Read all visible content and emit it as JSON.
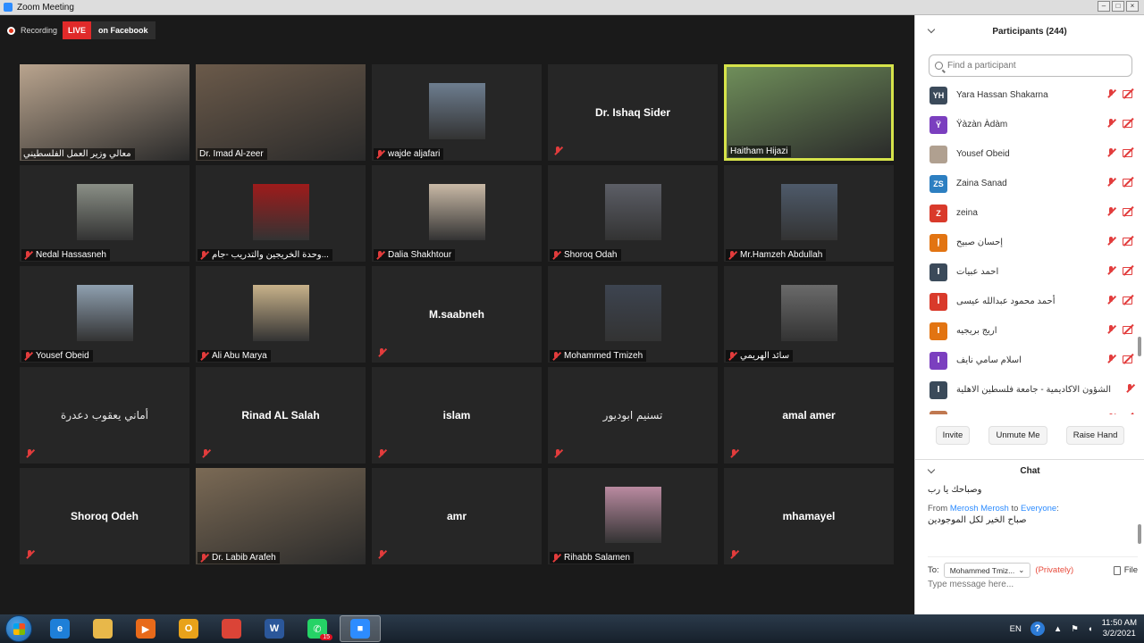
{
  "window": {
    "title": "Zoom Meeting"
  },
  "topbar": {
    "recording_label": "Recording",
    "live_label": "LIVE",
    "platform_label": "on Facebook"
  },
  "tiles": [
    {
      "name": "معالي وزير العمل الفلسطيني",
      "muted": false,
      "type": "video",
      "bg": "#b9a48e"
    },
    {
      "name": "Dr. Imad Al-zeer",
      "muted": false,
      "type": "video",
      "bg": "#6b5a4a"
    },
    {
      "name": "wajde aljafari",
      "muted": true,
      "type": "photo",
      "bg": "#6d7d8f"
    },
    {
      "name": "Dr. Ishaq Sider",
      "muted": true,
      "type": "name"
    },
    {
      "name": "Haitham Hijazi",
      "muted": false,
      "type": "video",
      "bg": "#6f8e5a",
      "active": true
    },
    {
      "name": "Nedal Hassasneh",
      "muted": true,
      "type": "photo",
      "bg": "#8a8f86"
    },
    {
      "name": "وحدة الخريجين والتدريب -جام...",
      "muted": true,
      "type": "photo",
      "bg": "#9e1b1b"
    },
    {
      "name": "Dalia Shakhtour",
      "muted": true,
      "type": "photo",
      "bg": "#c9b9a6"
    },
    {
      "name": "Shoroq Odah",
      "muted": true,
      "type": "photo",
      "bg": "#5c5e66"
    },
    {
      "name": "Mr.Hamzeh Abdullah",
      "muted": true,
      "type": "photo",
      "bg": "#4e5a6a"
    },
    {
      "name": "Yousef Obeid",
      "muted": true,
      "type": "photo",
      "bg": "#8fa0b0"
    },
    {
      "name": "Ali Abu Marya",
      "muted": true,
      "type": "photo",
      "bg": "#c8b28a"
    },
    {
      "name": "M.saabneh",
      "muted": true,
      "type": "name"
    },
    {
      "name": "Mohammed Tmizeh",
      "muted": true,
      "type": "photo",
      "bg": "#3d4450"
    },
    {
      "name": "سائد الهريمي",
      "muted": true,
      "type": "photo",
      "bg": "#6a6a6a"
    },
    {
      "name": "أماني يعقوب دعدرة",
      "muted": true,
      "type": "name",
      "arabic": true
    },
    {
      "name": "Rinad AL Salah",
      "muted": true,
      "type": "name"
    },
    {
      "name": "islam",
      "muted": true,
      "type": "name"
    },
    {
      "name": "تسنيم ابوديور",
      "muted": true,
      "type": "name",
      "arabic": true
    },
    {
      "name": "amal amer",
      "muted": true,
      "type": "name"
    },
    {
      "name": "Shoroq Odeh",
      "muted": true,
      "type": "name"
    },
    {
      "name": "Dr. Labib Arafeh",
      "muted": true,
      "type": "video",
      "bg": "#7b6a55"
    },
    {
      "name": "amr",
      "muted": true,
      "type": "name"
    },
    {
      "name": "Rihabb Salamen",
      "muted": true,
      "type": "photo",
      "bg": "#b98aa0"
    },
    {
      "name": "mhamayel",
      "muted": true,
      "type": "name"
    }
  ],
  "participants_panel": {
    "title": "Participants (244)",
    "search_placeholder": "Find a participant",
    "participants": [
      {
        "initials": "YH",
        "name": "Yara Hassan Shakarna",
        "color": "#3b4a5a"
      },
      {
        "initials": "Ÿ",
        "name": "Ÿàzàn Àdàm",
        "color": "#7b3fbf"
      },
      {
        "initials": "",
        "name": "Yousef Obeid",
        "color": "#b0a090",
        "photo": true
      },
      {
        "initials": "ZS",
        "name": "Zaina Sanad",
        "color": "#2d7fc1"
      },
      {
        "initials": "Z",
        "name": "zeina",
        "color": "#d93a2b"
      },
      {
        "initials": "إ",
        "name": "إحسان صبيح",
        "color": "#e27412"
      },
      {
        "initials": "ا",
        "name": "احمد عبيات",
        "color": "#3b4a5a"
      },
      {
        "initials": "أ",
        "name": "أحمد محمود عبدالله عيسى",
        "color": "#d93a2b"
      },
      {
        "initials": "ا",
        "name": "اريج بريجيه",
        "color": "#e27412"
      },
      {
        "initials": "ا",
        "name": "اسلام سامي نايف",
        "color": "#7b3fbf"
      },
      {
        "initials": "ا",
        "name": "الشؤون الاكاديمية - جامعة فلسطين الاهلية",
        "color": "#3b4a5a",
        "no_video_icon": true
      },
      {
        "initials": "",
        "name": "الاكاديمية خالد حسن",
        "color": "#c07850",
        "photo": true
      }
    ],
    "buttons": {
      "invite": "Invite",
      "unmute_me": "Unmute Me",
      "raise_hand": "Raise Hand"
    }
  },
  "chat": {
    "title": "Chat",
    "messages": [
      {
        "text": "وصباحك يا رب"
      },
      {
        "from": "Merosh Merosh",
        "to": "Everyone",
        "from_prefix": "From",
        "to_word": "to",
        "text": "صباح الخير لكل الموجودين"
      }
    ],
    "to_label": "To:",
    "recipient": "Mohammed Tmiz...",
    "privately": "(Privately)",
    "file_label": "File",
    "input_placeholder": "Type message here..."
  },
  "taskbar": {
    "apps": [
      {
        "icon": "ie-icon",
        "color": "#1e7fd8",
        "glyph": "e"
      },
      {
        "icon": "folder-icon",
        "color": "#e8b84a",
        "glyph": ""
      },
      {
        "icon": "media-player-icon",
        "color": "#e86a1a",
        "glyph": "▶"
      },
      {
        "icon": "outlook-icon",
        "color": "#e8a21a",
        "glyph": "O"
      },
      {
        "icon": "chrome-icon",
        "color": "#db4437",
        "glyph": ""
      },
      {
        "icon": "word-icon",
        "color": "#2b579a",
        "glyph": "W"
      },
      {
        "icon": "whatsapp-icon",
        "color": "#25d366",
        "glyph": "✆",
        "badge": "15"
      },
      {
        "icon": "zoom-icon",
        "color": "#2d8cff",
        "glyph": "■",
        "active": true
      }
    ],
    "language": "EN",
    "time": "11:50 AM",
    "date": "3/2/2021"
  }
}
